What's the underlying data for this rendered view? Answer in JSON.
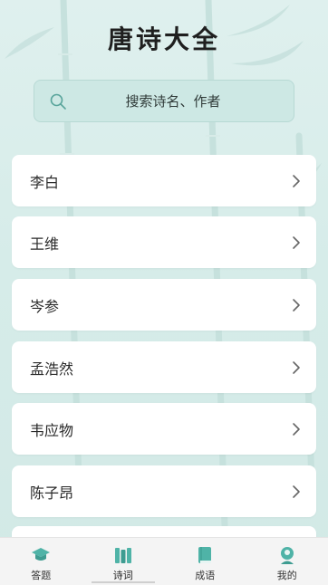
{
  "app": {
    "title": "唐诗大全"
  },
  "search": {
    "placeholder": "搜索诗名、作者",
    "icon": "search-icon"
  },
  "poets": [
    {
      "name": "李白"
    },
    {
      "name": "王维"
    },
    {
      "name": "岑参"
    },
    {
      "name": "孟浩然"
    },
    {
      "name": "韦应物"
    },
    {
      "name": "陈子昂"
    }
  ],
  "tabbar": {
    "items": [
      {
        "label": "答题",
        "icon": "graduation-cap-icon"
      },
      {
        "label": "诗词",
        "icon": "books-icon",
        "active": true
      },
      {
        "label": "成语",
        "icon": "book-icon"
      },
      {
        "label": "我的",
        "icon": "user-icon"
      }
    ]
  },
  "colors": {
    "accent": "#4fb3a7",
    "background": "#d6ece9",
    "card": "#ffffff"
  }
}
